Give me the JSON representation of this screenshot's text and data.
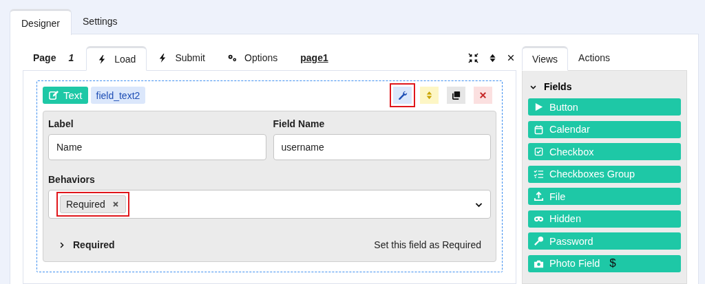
{
  "main_tabs": [
    {
      "label": "Designer",
      "selected": true
    },
    {
      "label": "Settings",
      "selected": false
    }
  ],
  "page_bar": {
    "page_label": "Page",
    "page_number": "1",
    "tabs": [
      {
        "label": "Load",
        "kind": "bolt",
        "selected": true
      },
      {
        "label": "Submit",
        "kind": "bolt",
        "selected": false
      },
      {
        "label": "Options",
        "kind": "gears",
        "selected": false
      }
    ],
    "page_name": "page1"
  },
  "field": {
    "type_badge": "Text",
    "name_badge": "field_text2",
    "tools": [
      {
        "kind": "settings",
        "highlighted": true
      },
      {
        "kind": "move",
        "highlighted": false
      },
      {
        "kind": "copy",
        "highlighted": false
      },
      {
        "kind": "delete",
        "highlighted": false
      }
    ],
    "label": {
      "title": "Label",
      "value": "Name"
    },
    "field_name": {
      "title": "Field Name",
      "value": "username"
    },
    "behaviors": {
      "title": "Behaviors",
      "tags": [
        {
          "label": "Required",
          "highlighted": true
        }
      ]
    },
    "rules": [
      {
        "title": "Required",
        "description": "Set this field as Required",
        "expanded": false
      }
    ]
  },
  "side_tabs": [
    {
      "label": "Views",
      "selected": true
    },
    {
      "label": "Actions",
      "selected": false
    }
  ],
  "side_panel": {
    "title": "Fields",
    "expanded": true,
    "items": [
      {
        "label": "Button",
        "kind": "play"
      },
      {
        "label": "Calendar",
        "kind": "calendar"
      },
      {
        "label": "Checkbox",
        "kind": "checkbox"
      },
      {
        "label": "Checkboxes Group",
        "kind": "checklist"
      },
      {
        "label": "File",
        "kind": "upload"
      },
      {
        "label": "Hidden",
        "kind": "mask"
      },
      {
        "label": "Password",
        "kind": "key"
      },
      {
        "label": "Photo Field",
        "kind": "camera",
        "badge": "$"
      }
    ]
  }
}
